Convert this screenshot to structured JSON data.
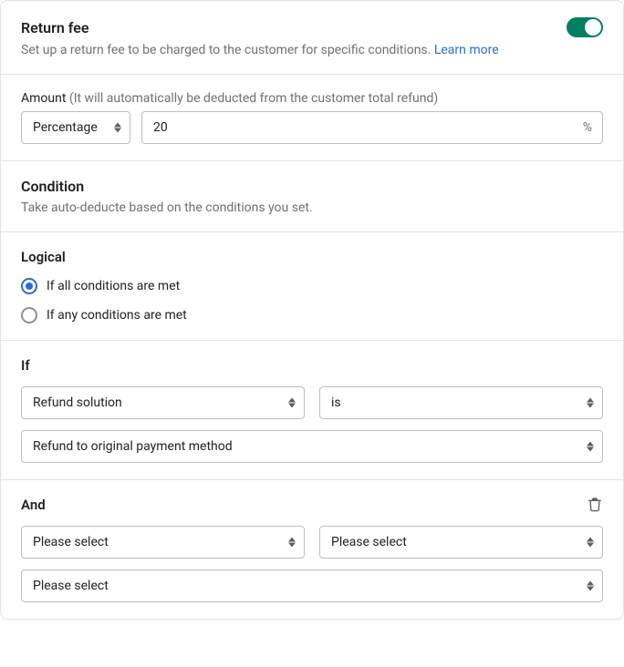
{
  "header": {
    "title": "Return fee",
    "subtitle": "Set up a return fee to be charged to the customer for specific conditions. ",
    "learn_more": "Learn more"
  },
  "amount": {
    "label": "Amount ",
    "hint": "(It will automatically be deducted from the customer total refund)",
    "type": "Percentage",
    "value": "20",
    "suffix": "%"
  },
  "condition": {
    "title": "Condition",
    "desc": "Take auto-deducte based on the conditions you set."
  },
  "logical": {
    "title": "Logical",
    "all": "If all conditions are met",
    "any": "If any conditions are met"
  },
  "if_group": {
    "title": "If",
    "field": "Refund solution",
    "operator": "is",
    "value": "Refund to original payment method"
  },
  "and_group": {
    "title": "And",
    "field": "Please select",
    "operator": "Please select",
    "value": "Please select"
  }
}
